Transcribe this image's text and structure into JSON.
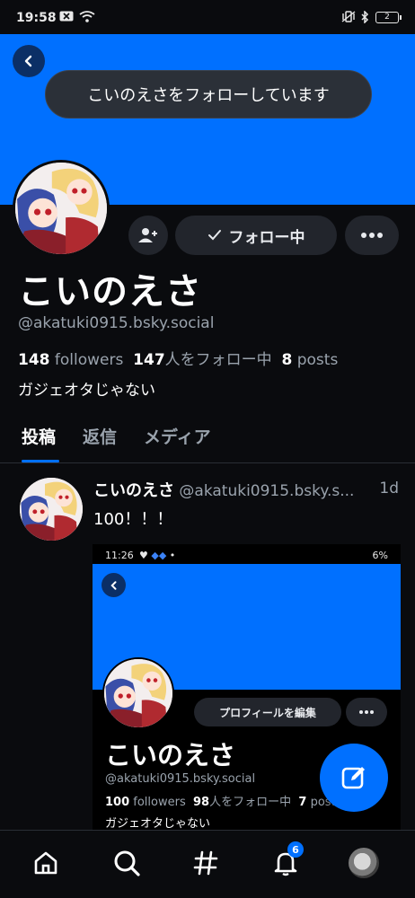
{
  "status_bar": {
    "time": "19:58",
    "battery": "2"
  },
  "toast": {
    "text": "こいのえさをフォローしています"
  },
  "profile": {
    "display_name": "こいのえさ",
    "handle": "@akatuki0915.bsky.social",
    "followers_count": "148",
    "followers_label": "followers",
    "following_count": "147",
    "following_label": "人をフォロー中",
    "posts_count": "8",
    "posts_label": "posts",
    "bio": "ガジェオタじゃない",
    "following_button": "フォロー中"
  },
  "tabs": [
    {
      "label": "投稿"
    },
    {
      "label": "返信"
    },
    {
      "label": "メディア"
    }
  ],
  "post": {
    "author_name": "こいのえさ",
    "author_handle": "@akatuki0915.bsky.s...",
    "time": "1d",
    "text": "100！！！"
  },
  "embedded_screenshot": {
    "time": "11:26",
    "status_right": "6%",
    "edit_button": "プロフィールを編集",
    "display_name": "こいのえさ",
    "handle": "@akatuki0915.bsky.social",
    "followers_count": "100",
    "followers_label": "followers",
    "following_count": "98",
    "following_label": "人をフォロー中",
    "posts_count": "7",
    "posts_label": "posts",
    "bio": "ガジェオタじゃない"
  },
  "bottom_nav": {
    "notifications_badge": "6"
  },
  "colors": {
    "accent": "#0070ff",
    "background": "#0a0b0e",
    "surface": "#22252c",
    "muted_text": "#9aa3ad"
  }
}
